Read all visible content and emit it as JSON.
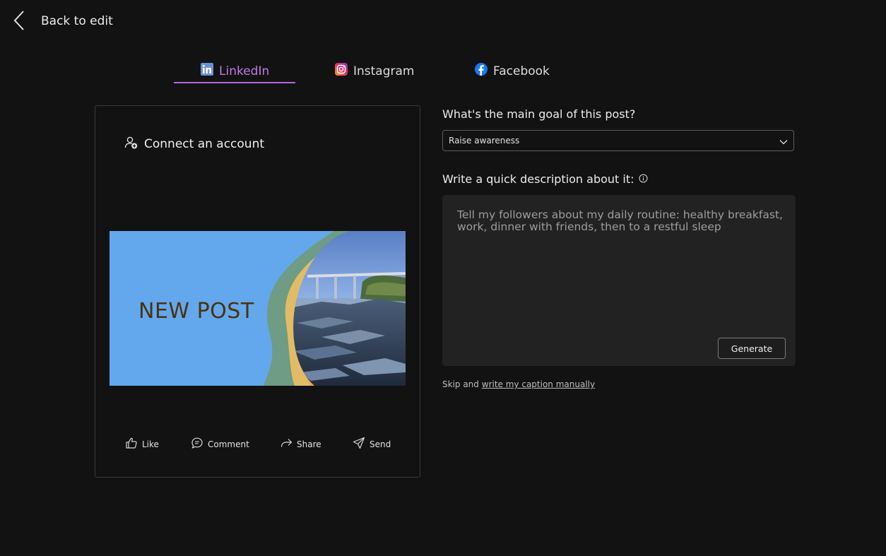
{
  "header": {
    "back_label": "Back to edit"
  },
  "tabs": [
    {
      "label": "LinkedIn",
      "icon": "linkedin-icon",
      "active": true
    },
    {
      "label": "Instagram",
      "icon": "instagram-icon",
      "active": false
    },
    {
      "label": "Facebook",
      "icon": "facebook-icon",
      "active": false
    }
  ],
  "preview": {
    "connect_label": "Connect an account",
    "post_image_text": "NEW POST",
    "actions": [
      {
        "label": "Like",
        "icon": "like-icon"
      },
      {
        "label": "Comment",
        "icon": "comment-icon"
      },
      {
        "label": "Share",
        "icon": "share-icon"
      },
      {
        "label": "Send",
        "icon": "send-icon"
      }
    ]
  },
  "form": {
    "goal_label": "What's the main goal of this post?",
    "goal_value": "Raise awareness",
    "description_label": "Write a quick description about it:",
    "description_text": "Tell my followers about my daily routine: healthy breakfast, work, dinner with friends, then to a restful sleep",
    "generate_label": "Generate",
    "skip_prefix": "Skip and",
    "skip_link": "write my caption manually"
  },
  "colors": {
    "background": "#121212",
    "accent": "#b865e8",
    "panel": "#222222"
  }
}
